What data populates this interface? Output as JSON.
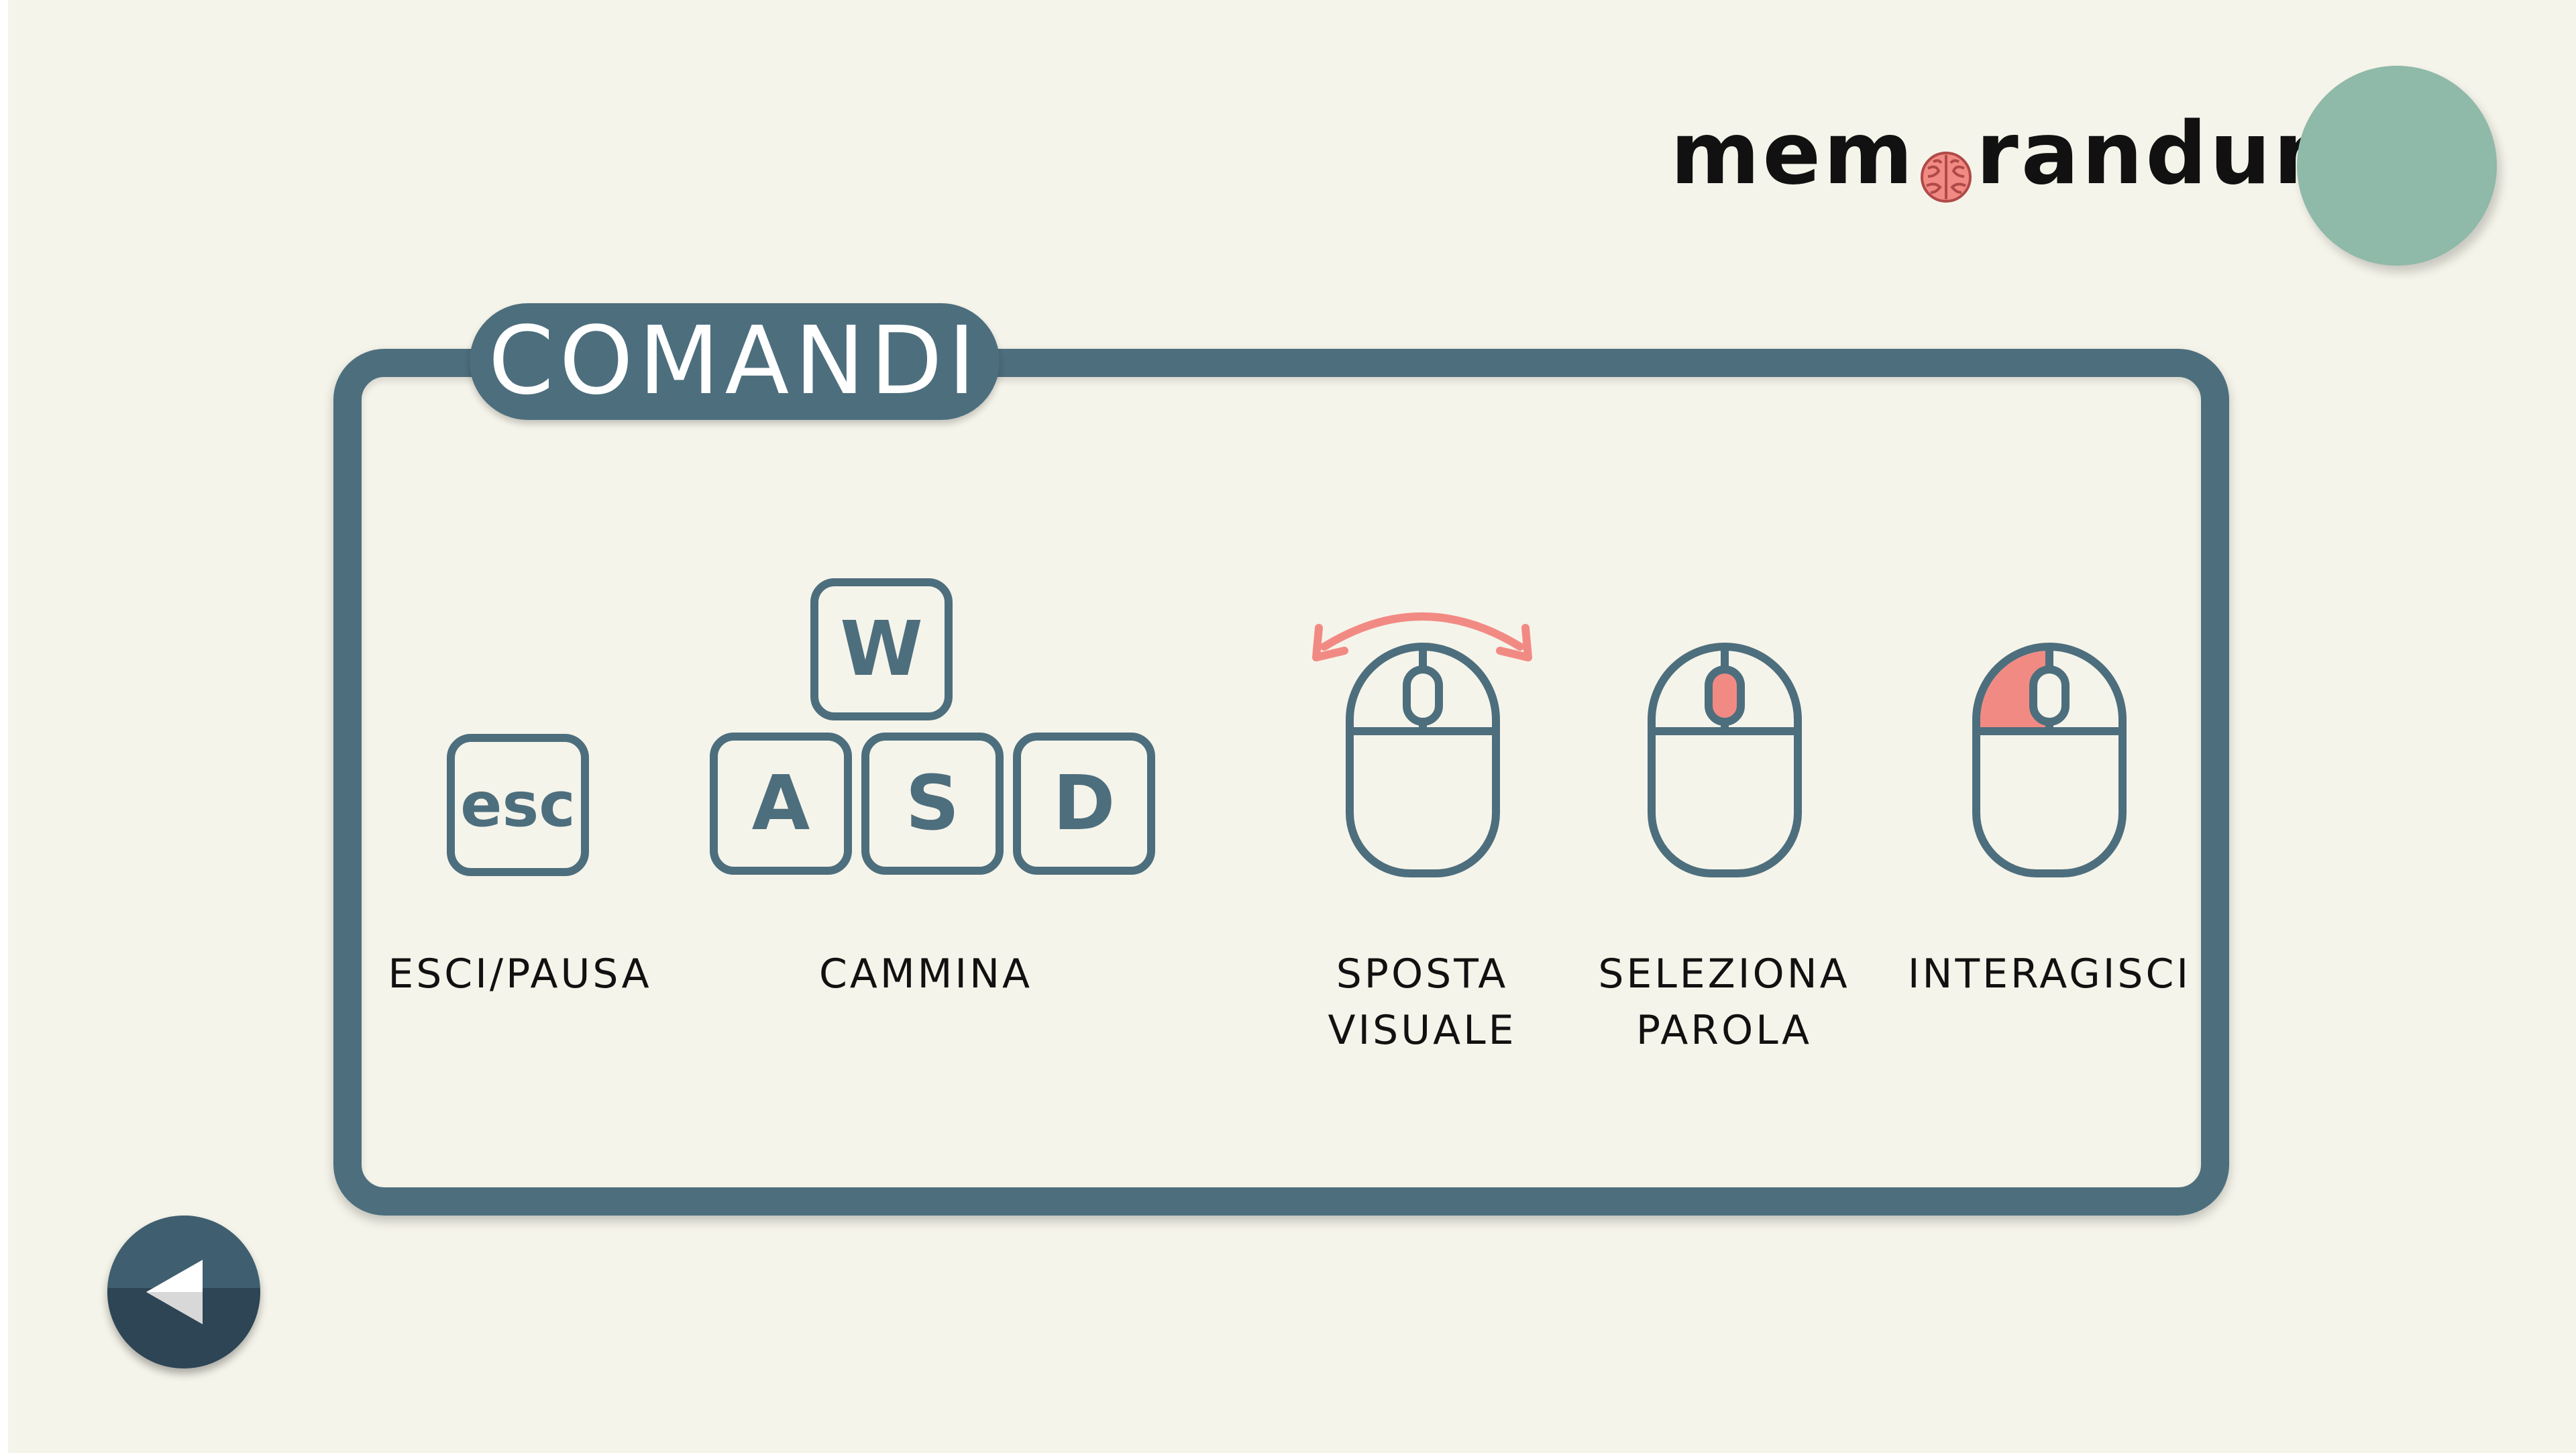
{
  "brand": {
    "logo_left": "mem",
    "logo_right": "randum"
  },
  "panel": {
    "title": "COMANDI"
  },
  "keys": {
    "esc": "esc",
    "w": "W",
    "a": "A",
    "s": "S",
    "d": "D"
  },
  "labels": {
    "esc_pausa": "ESCI/PAUSA",
    "cammina": "CAMMINA",
    "sposta_1": "SPOSTA",
    "sposta_2": "VISUALE",
    "seleziona_1": "SELEZIONA",
    "seleziona_2": "PAROLA",
    "interagisci": "INTERAGISCI"
  },
  "colors": {
    "background": "#f5f4ea",
    "panel": "#4d6e7d",
    "accent": "#f28a84",
    "circle": "#8fb9a8",
    "back_button": "#2d4555"
  },
  "icons": {
    "back": "back-arrow-icon",
    "brain": "brain-icon",
    "mouse": "mouse-icon",
    "move_arrow": "double-arrow-icon"
  }
}
